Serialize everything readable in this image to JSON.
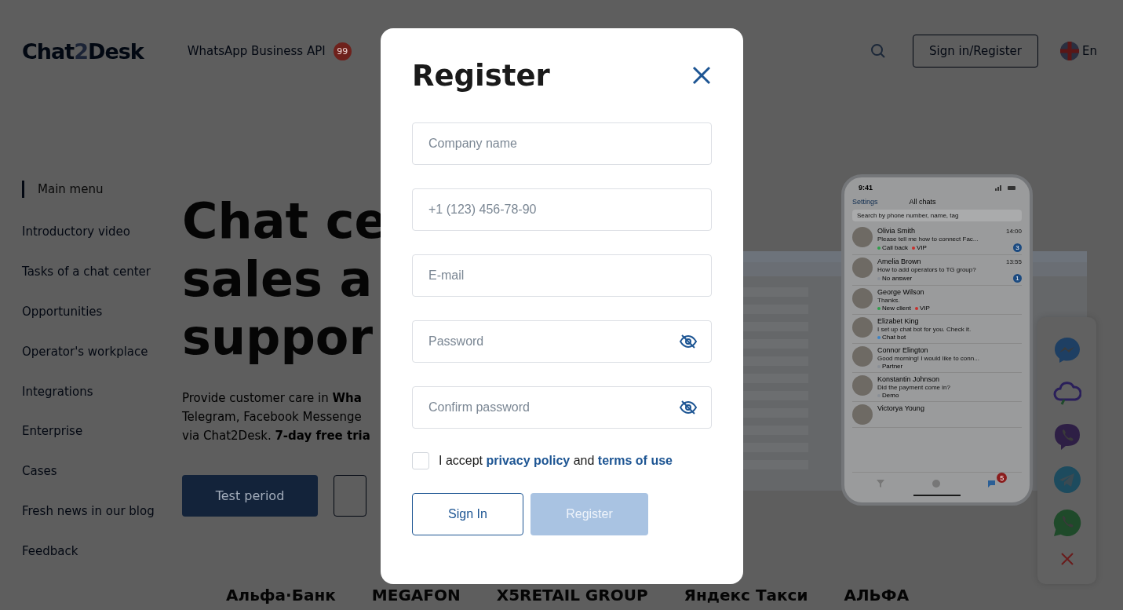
{
  "header": {
    "logo": [
      "Chat",
      "2",
      "Desk"
    ],
    "nav_link": "WhatsApp Business API",
    "nav_badge": "99",
    "sign_in_button": "Sign in/Register",
    "language": "En"
  },
  "sidebar": {
    "title": "Main menu",
    "items": [
      "Introductory video",
      "Tasks of a chat center",
      "Opportunities",
      "Operator's workplace",
      "Integrations",
      "Enterprise",
      "Cases",
      "Fresh news in our blog",
      "Feedback"
    ]
  },
  "hero": {
    "heading_lines": [
      "Chat ce",
      "sales a",
      "suppor"
    ],
    "paragraph_lines": [
      "Provide customer care in **Wha**",
      "Telegram, Facebook Messenge",
      "via Chat2Desk. **7-day free tria**"
    ],
    "primary_button": "Test period"
  },
  "phone": {
    "time": "9:41",
    "back_link": "Settings",
    "title": "All chats",
    "search_placeholder": "Search by phone number, name, tag",
    "chats": [
      {
        "name": "Olivia Smith",
        "time": "14:00",
        "message": "Please tell me how to connect Fac...",
        "tags": [
          {
            "label": "Call back",
            "color": "#2e9e4a"
          },
          {
            "label": "VIP",
            "color": "#c8302c"
          }
        ],
        "unread": "3"
      },
      {
        "name": "Amelia Brown",
        "time": "13:55",
        "message": "How to add operators to TG group?",
        "tags": [
          {
            "label": "No answer",
            "color": "#8a8f96"
          }
        ],
        "unread": "1"
      },
      {
        "name": "George Wilson",
        "message": "Thanks.",
        "tags": [
          {
            "label": "New client",
            "color": "#2e9e4a"
          },
          {
            "label": "VIP",
            "color": "#c8302c"
          }
        ]
      },
      {
        "name": "Elizabet King",
        "message": "I set up chat bot for you. Check it.",
        "tags": [
          {
            "label": "Chat bot",
            "color": "#3b82c4"
          }
        ]
      },
      {
        "name": "Connor Elington",
        "message": "Good morning! I would like to conn...",
        "tags": [
          {
            "label": "Partner",
            "color": "#8a8f96"
          }
        ]
      },
      {
        "name": "Konstantin Johnson",
        "message": "Did the payment come in?",
        "tags": [
          {
            "label": "Demo",
            "color": "#8a8f96"
          }
        ]
      },
      {
        "name": "Victorya Young"
      }
    ],
    "tab_badge": "5"
  },
  "messenger_widget": [
    {
      "kind": "messenger"
    },
    {
      "kind": "cloud"
    },
    {
      "kind": "viber"
    },
    {
      "kind": "telegram"
    },
    {
      "kind": "whatsapp"
    },
    {
      "kind": "close"
    }
  ],
  "partners": [
    "Альфа·Банк",
    "MEGAFON",
    "X5RETAIL GROUP",
    "Яндекс Такси",
    "АЛЬФА"
  ],
  "modal": {
    "title": "Register",
    "fields": [
      {
        "placeholder": "Company name",
        "kind": "text"
      },
      {
        "placeholder": "+1 (123) 456-78-90",
        "kind": "text"
      },
      {
        "placeholder": "E-mail",
        "kind": "text"
      },
      {
        "placeholder": "Password",
        "kind": "password"
      },
      {
        "placeholder": "Confirm password",
        "kind": "password"
      }
    ],
    "consent": {
      "checked": false,
      "parts": [
        {
          "kind": "text",
          "text": "I accept"
        },
        {
          "kind": "link",
          "text": "privacy policy"
        },
        {
          "kind": "text",
          "text": "and"
        },
        {
          "kind": "link",
          "text": "terms of use"
        }
      ]
    },
    "buttons": [
      {
        "label": "Sign In",
        "kind": "outline",
        "disabled": false
      },
      {
        "label": "Register",
        "kind": "primary",
        "disabled": true
      }
    ]
  }
}
